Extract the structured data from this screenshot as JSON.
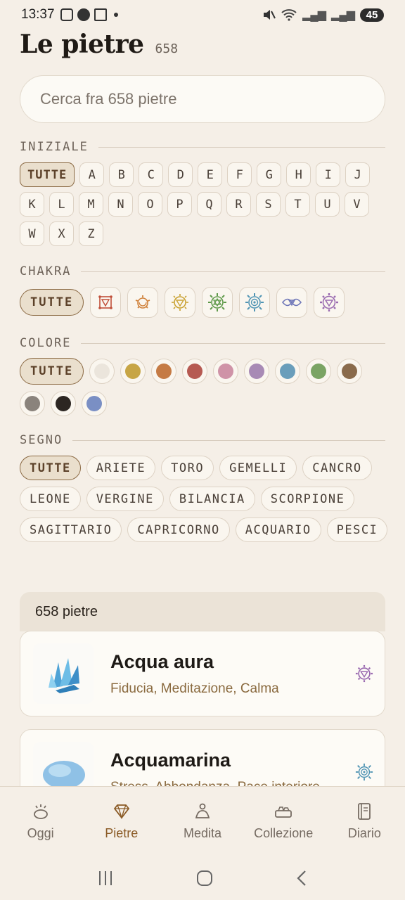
{
  "status_bar": {
    "time": "13:37",
    "battery": "45"
  },
  "header": {
    "title": "Le pietre",
    "count": "658"
  },
  "search": {
    "placeholder": "Cerca fra 658 pietre"
  },
  "filters": {
    "initial": {
      "label": "INIZIALE",
      "all_label": "TUTTE",
      "letters": [
        "A",
        "B",
        "C",
        "D",
        "E",
        "F",
        "G",
        "H",
        "I",
        "J",
        "K",
        "L",
        "M",
        "N",
        "O",
        "P",
        "Q",
        "R",
        "S",
        "T",
        "U",
        "V",
        "W",
        "X",
        "Z"
      ]
    },
    "chakra": {
      "label": "CHAKRA",
      "all_label": "TUTTE",
      "items": [
        {
          "icon": "root-chakra-icon",
          "color": "#c0503a"
        },
        {
          "icon": "sacral-chakra-icon",
          "color": "#d0823c"
        },
        {
          "icon": "solar-plexus-chakra-icon",
          "color": "#c9a232"
        },
        {
          "icon": "heart-chakra-icon",
          "color": "#5f9a4a"
        },
        {
          "icon": "throat-chakra-icon",
          "color": "#4f94b4"
        },
        {
          "icon": "third-eye-chakra-icon",
          "color": "#6f77b8"
        },
        {
          "icon": "crown-chakra-icon",
          "color": "#9a6ab0"
        }
      ]
    },
    "color": {
      "label": "COLORE",
      "all_label": "TUTTE",
      "swatches": [
        "#ebe5dc",
        "#c7a545",
        "#c57b45",
        "#b65a52",
        "#cf93a7",
        "#a88ab5",
        "#6a9ebb",
        "#7aa464",
        "#8a6b4c",
        "#8a837c",
        "#2c2622",
        "#7a8fc4"
      ]
    },
    "sign": {
      "label": "SEGNO",
      "all_label": "TUTTE",
      "items": [
        "ARIETE",
        "TORO",
        "GEMELLI",
        "CANCRO",
        "LEONE",
        "VERGINE",
        "BILANCIA",
        "SCORPIONE",
        "SAGITTARIO",
        "CAPRICORNO",
        "ACQUARIO",
        "PESCI"
      ]
    }
  },
  "results": {
    "count_label": "658 pietre",
    "stones": [
      {
        "name": "Acqua aura",
        "properties": "Fiducia, Meditazione, Calma",
        "chakra_icon": "crown-chakra-icon",
        "chakra_color": "#9a6ab0"
      },
      {
        "name": "Acquamarina",
        "properties": "Stress, Abbondanza, Pace interiore",
        "chakra_icon": "throat-chakra-icon",
        "chakra_color": "#4f94b4"
      }
    ]
  },
  "bottom_nav": [
    {
      "label": "Oggi",
      "icon": "sun-icon"
    },
    {
      "label": "Pietre",
      "icon": "gem-icon",
      "active": true
    },
    {
      "label": "Medita",
      "icon": "meditate-icon"
    },
    {
      "label": "Collezione",
      "icon": "collection-icon"
    },
    {
      "label": "Diario",
      "icon": "journal-icon"
    }
  ]
}
